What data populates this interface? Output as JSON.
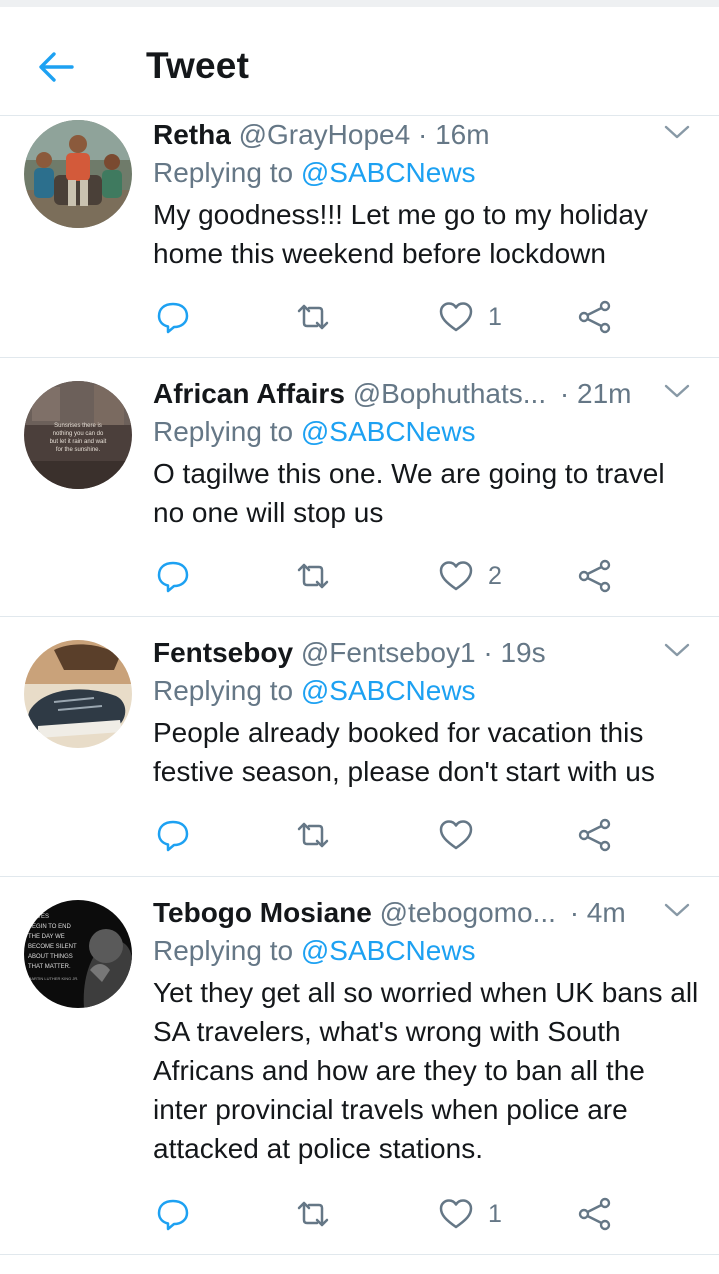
{
  "header": {
    "title": "Tweet"
  },
  "colors": {
    "accent": "#1da1f2",
    "muted": "#657786",
    "text": "#14171a",
    "divider": "#e1e8ed"
  },
  "icons": [
    "back-arrow-icon",
    "chevron-down-icon",
    "reply-icon",
    "retweet-icon",
    "heart-icon",
    "share-icon"
  ],
  "tweets": [
    {
      "name": "Retha",
      "handle": "@GrayHope4",
      "time": "· 16m",
      "replying_prefix": "Replying to",
      "replying_to": "@SABCNews",
      "text": "My goodness!!! Let me go to my holiday home this weekend before lockdown",
      "likes": "1"
    },
    {
      "name": "African Affairs",
      "handle": "@Bophuthats...",
      "time": "· 21m",
      "replying_prefix": "Replying to",
      "replying_to": "@SABCNews",
      "text": "O tagilwe this one. We are going to travel no one will stop us",
      "likes": "2",
      "avatar_text": [
        "Sunsrises there is",
        "nothing you can do",
        "but let it rain and wait",
        "for the sunshine."
      ]
    },
    {
      "name": "Fentseboy",
      "handle": "@Fentseboy1",
      "time": "· 19s",
      "replying_prefix": "Replying to",
      "replying_to": "@SABCNews",
      "text": "People already booked for vacation this festive season, please don't start with us",
      "likes": ""
    },
    {
      "name": "Tebogo Mosiane",
      "handle": "@tebogomo...",
      "time": "· 4m",
      "replying_prefix": "Replying to",
      "replying_to": "@SABCNews",
      "text": "Yet they get all so worried when UK bans all SA travelers, what's wrong with South Africans and how are they to ban all the inter provincial travels when police are attacked at police stations.",
      "likes": "1",
      "avatar_text": [
        "LIVES",
        "BEGIN TO END",
        "THE DAY WE",
        "BECOME SILENT",
        "ABOUT THINGS",
        "THAT MATTER.",
        "MARTIN LUTHER KING JR."
      ]
    }
  ]
}
